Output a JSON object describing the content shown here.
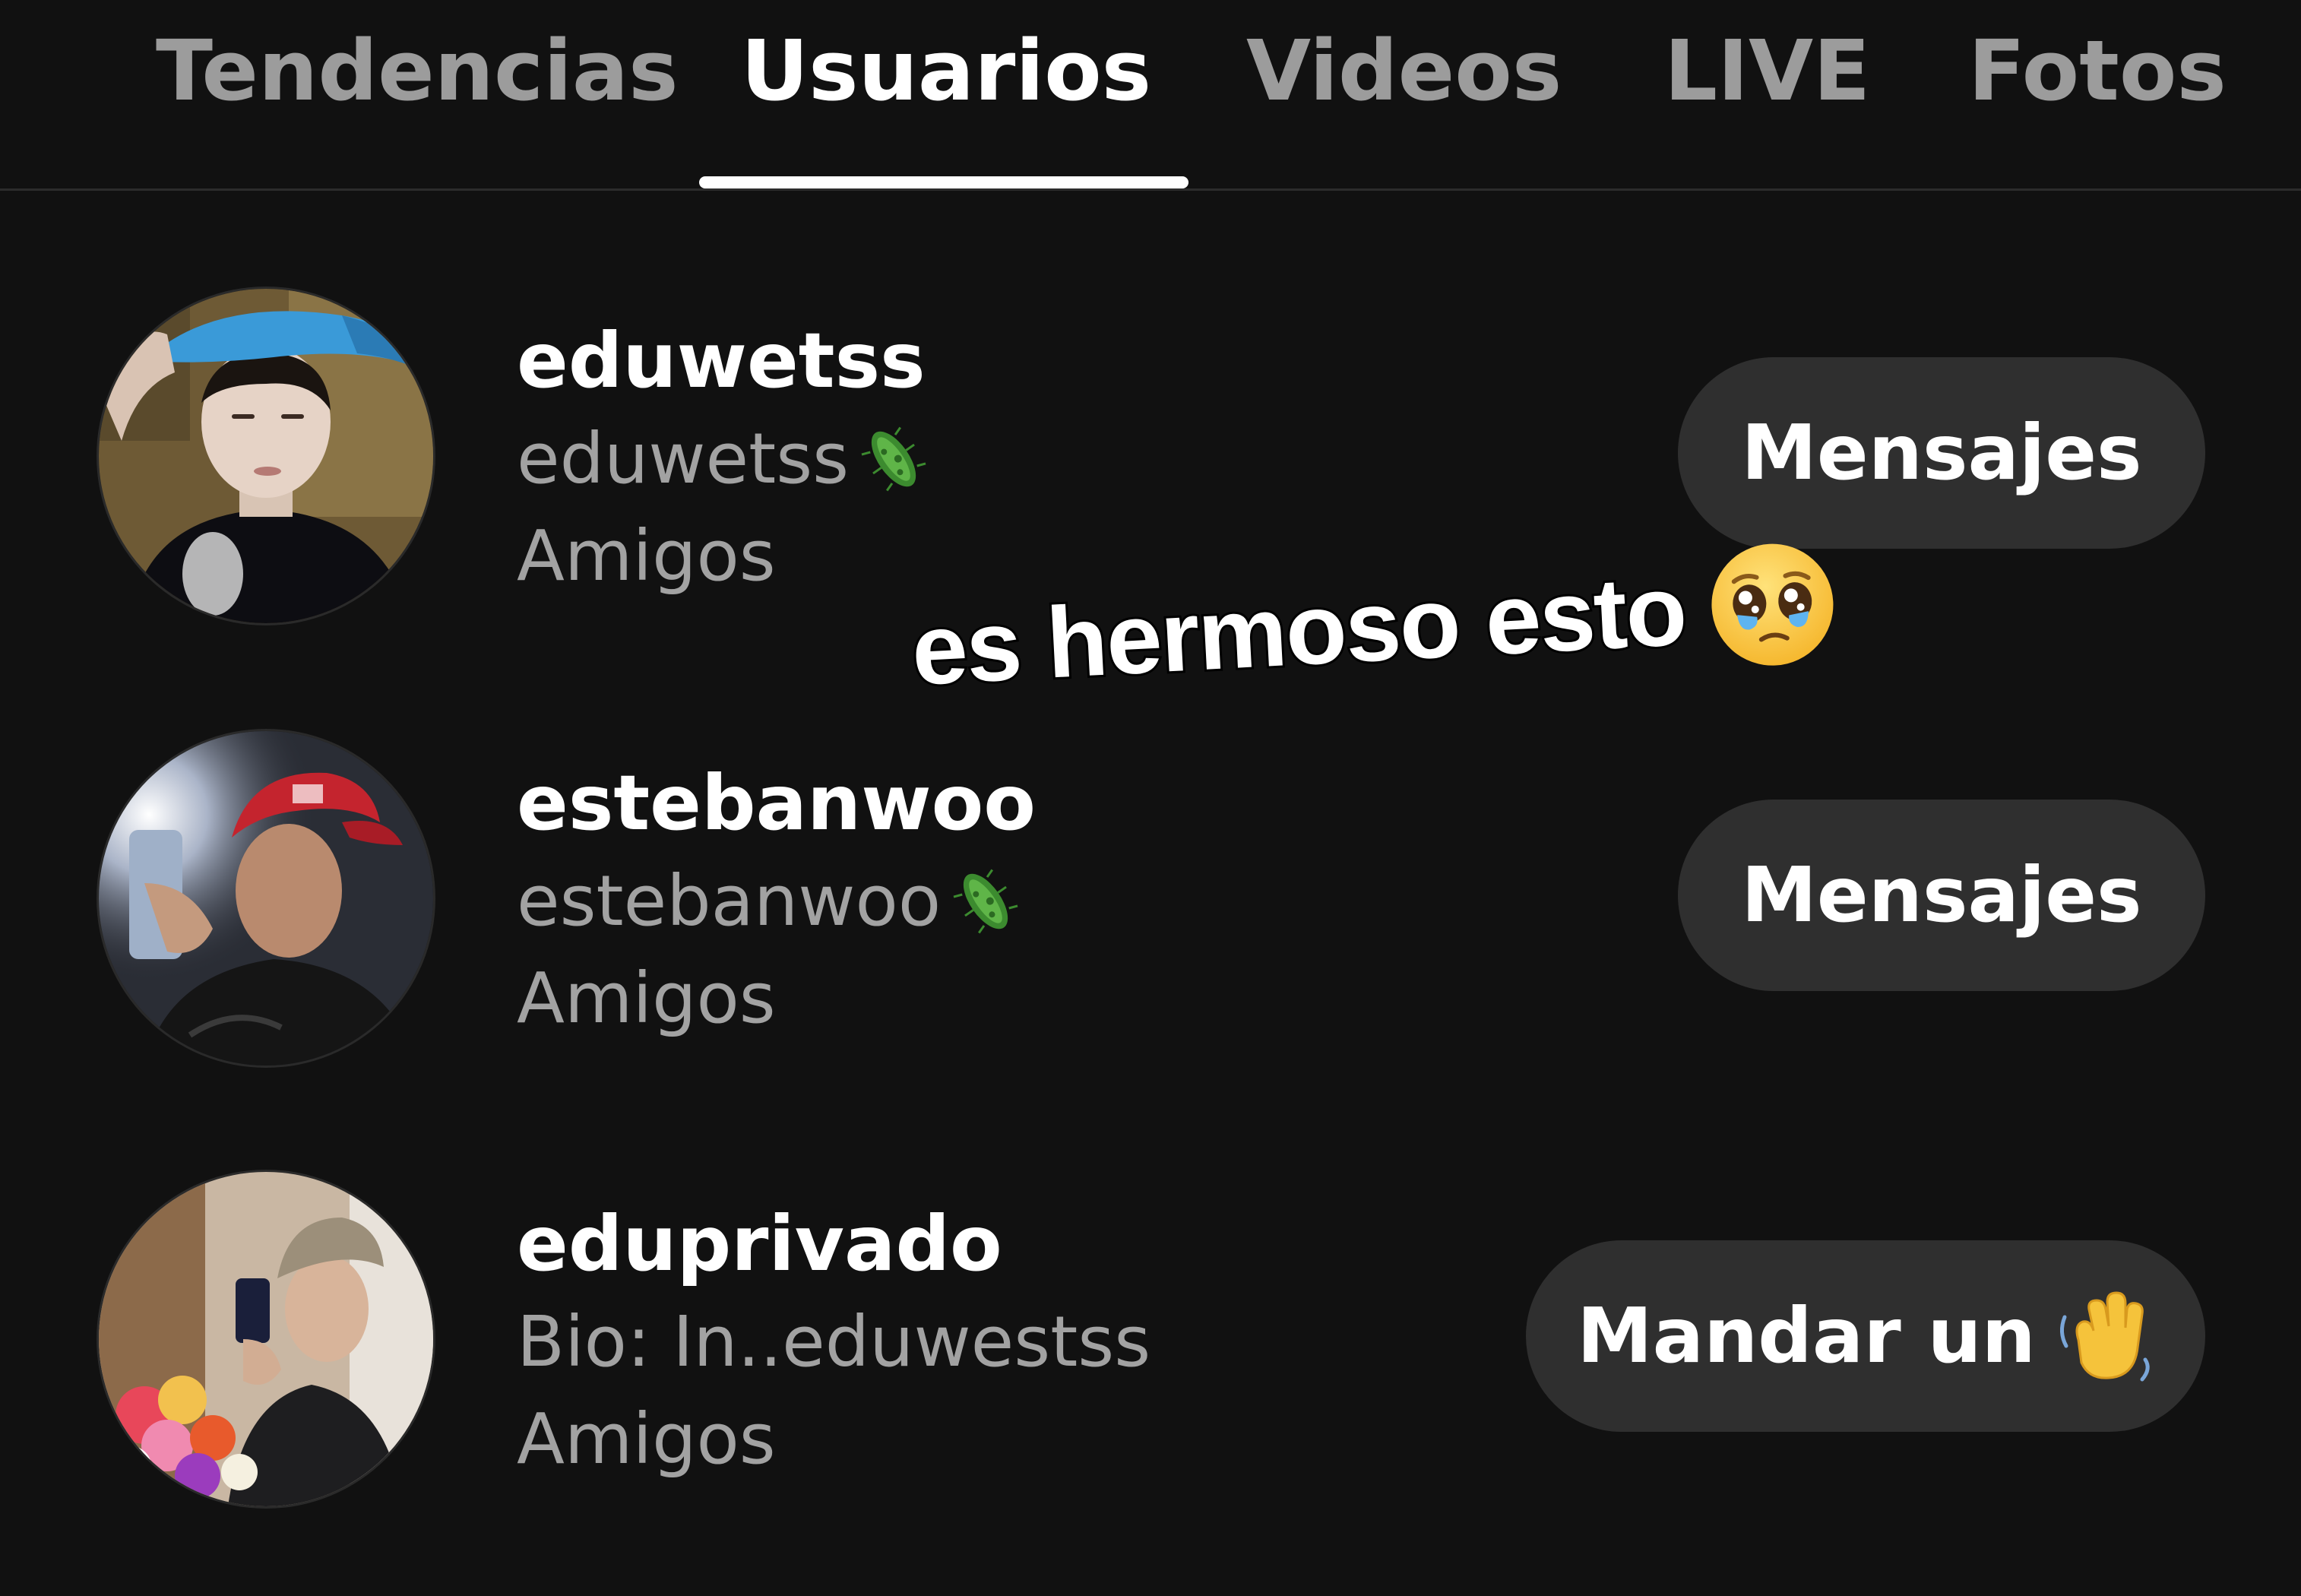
{
  "tabs": [
    {
      "label": "Tendencias",
      "active": false
    },
    {
      "label": "Usuarios",
      "active": true
    },
    {
      "label": "Videos",
      "active": false
    },
    {
      "label": "LIVE",
      "active": false
    },
    {
      "label": "Fotos",
      "active": false
    }
  ],
  "users": [
    {
      "username": "eduwetss",
      "subtitle": "eduwetss",
      "subtitle_icon": "microbe-icon",
      "relation": "Amigos",
      "action_label": "Mensajes"
    },
    {
      "username": "estebanwoo",
      "subtitle": "estebanwoo",
      "subtitle_icon": "microbe-icon",
      "relation": "Amigos",
      "action_label": "Mensajes"
    },
    {
      "username": "eduprivado",
      "subtitle": "Bio: In..eduwestss",
      "relation": "Amigos",
      "action_label": "Mandar un",
      "action_icon": "waving-hand-icon"
    }
  ],
  "overlay": {
    "caption": "es hermoso esto",
    "emoji": "pleading-face-icon"
  },
  "colors": {
    "background": "#111111",
    "tab_inactive": "#9c9c9c",
    "tab_active": "#ffffff",
    "secondary_text": "#a2a2a2",
    "button_bg": "#2f2f2f"
  }
}
